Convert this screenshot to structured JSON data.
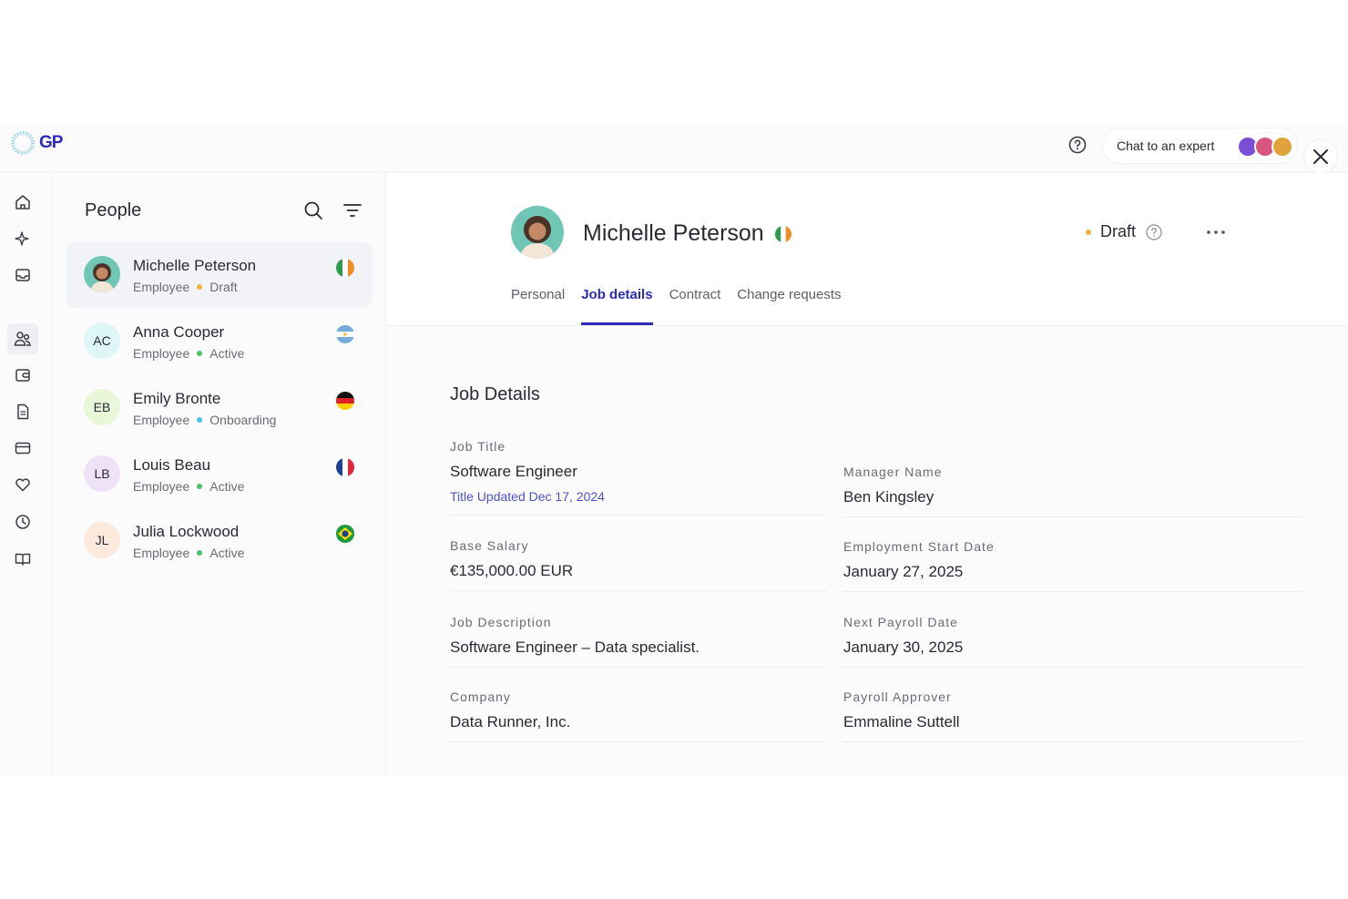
{
  "brand": {
    "logo_text": "GP"
  },
  "topbar": {
    "chat_label": "Chat to an expert",
    "colors": {
      "accent": "#2b2bb8"
    }
  },
  "people_panel": {
    "title": "People",
    "people": [
      {
        "name": "Michelle Peterson",
        "role": "Employee",
        "status": "Draft",
        "status_color": "#f1b33b",
        "initials": "",
        "flag": "ireland",
        "selected": true
      },
      {
        "name": "Anna Cooper",
        "role": "Employee",
        "status": "Active",
        "status_color": "#4cc36d",
        "initials": "AC",
        "flag": "argentina",
        "selected": false
      },
      {
        "name": "Emily Bronte",
        "role": "Employee",
        "status": "Onboarding",
        "status_color": "#46c2e6",
        "initials": "EB",
        "flag": "germany",
        "selected": false
      },
      {
        "name": "Louis Beau",
        "role": "Employee",
        "status": "Active",
        "status_color": "#4cc36d",
        "initials": "LB",
        "flag": "france",
        "selected": false
      },
      {
        "name": "Julia Lockwood",
        "role": "Employee",
        "status": "Active",
        "status_color": "#4cc36d",
        "initials": "JL",
        "flag": "brazil",
        "selected": false
      }
    ]
  },
  "employee": {
    "name": "Michelle Peterson",
    "status": "Draft",
    "tabs": [
      {
        "label": "Personal",
        "active": false
      },
      {
        "label": "Job details",
        "active": true
      },
      {
        "label": "Contract",
        "active": false
      },
      {
        "label": "Change requests",
        "active": false
      }
    ]
  },
  "job_details": {
    "title": "Job Details",
    "job_title": {
      "label": "Job Title",
      "value": "Software Engineer",
      "note": "Title Updated Dec 17, 2024"
    },
    "manager": {
      "label": "Manager Name",
      "value": "Ben Kingsley"
    },
    "salary": {
      "label": "Base Salary",
      "value": "€135,000.00 EUR"
    },
    "start_date": {
      "label": "Employment Start Date",
      "value": "January 27, 2025"
    },
    "description": {
      "label": "Job Description",
      "value": "Software Engineer – Data specialist."
    },
    "next_payroll": {
      "label": "Next Payroll Date",
      "value": "January 30, 2025"
    },
    "company": {
      "label": "Company",
      "value": "Data Runner, Inc."
    },
    "approver": {
      "label": "Payroll Approver",
      "value": "Emmaline Suttell"
    }
  }
}
